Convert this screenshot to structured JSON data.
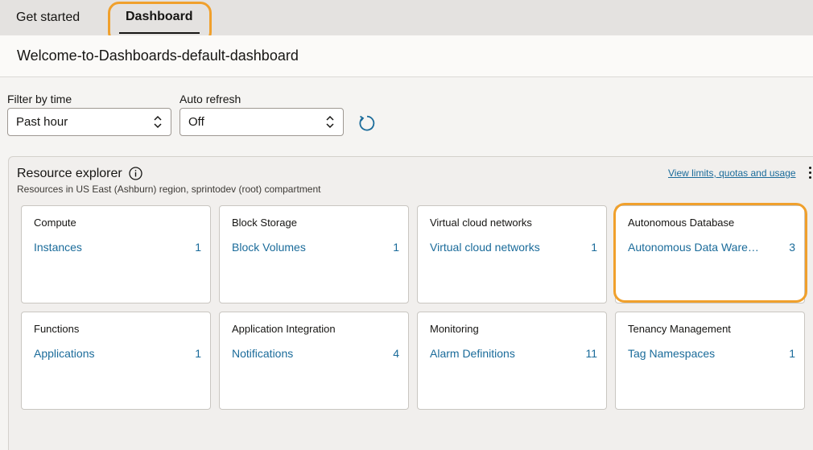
{
  "tabs": {
    "get_started": "Get started",
    "dashboard": "Dashboard"
  },
  "page_title": "Welcome-to-Dashboards-default-dashboard",
  "filters": {
    "time_label": "Filter by time",
    "time_value": "Past hour",
    "refresh_label": "Auto refresh",
    "refresh_value": "Off"
  },
  "resource_explorer": {
    "title": "Resource explorer",
    "subtitle": "Resources in US East (Ashburn) region, sprintodev (root) compartment",
    "limits_link": "View limits, quotas and usage",
    "cards": [
      {
        "title": "Compute",
        "link": "Instances",
        "count": "1"
      },
      {
        "title": "Block Storage",
        "link": "Block Volumes",
        "count": "1"
      },
      {
        "title": "Virtual cloud networks",
        "link": "Virtual cloud networks",
        "count": "1"
      },
      {
        "title": "Autonomous Database",
        "link": "Autonomous Data Ware…",
        "count": "3"
      },
      {
        "title": "Functions",
        "link": "Applications",
        "count": "1"
      },
      {
        "title": "Application Integration",
        "link": "Notifications",
        "count": "4"
      },
      {
        "title": "Monitoring",
        "link": "Alarm Definitions",
        "count": "11"
      },
      {
        "title": "Tenancy Management",
        "link": "Tag Namespaces",
        "count": "1"
      }
    ]
  },
  "colors": {
    "accent_link": "#1a6b9a",
    "highlight": "#f0a02c"
  },
  "icons": [
    "info-icon",
    "refresh-icon",
    "chevron-updown-icon",
    "kebab-menu-icon"
  ]
}
